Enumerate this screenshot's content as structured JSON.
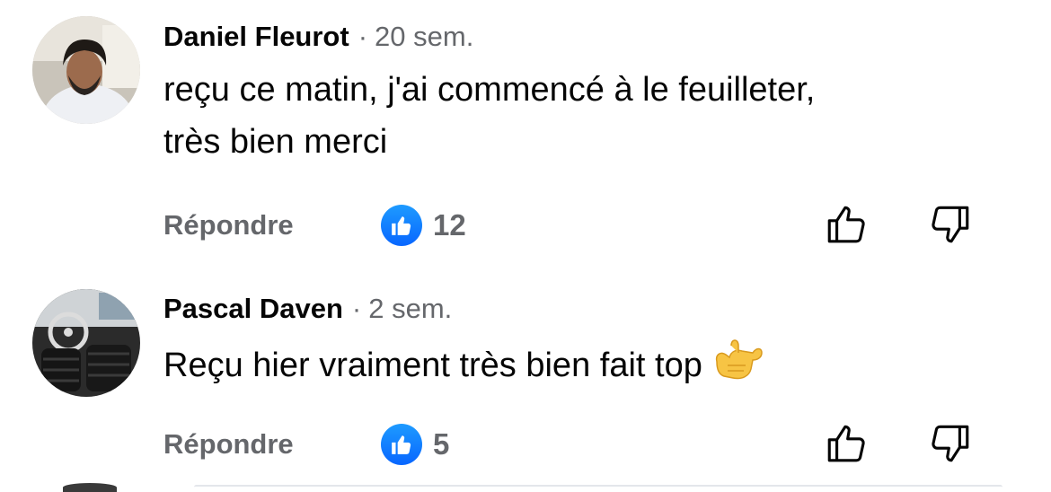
{
  "comments": [
    {
      "author": "Daniel Fleurot",
      "separator": "·",
      "time": "20 sem.",
      "text_line1": "reçu ce matin, j'ai commencé à le feuilleter,",
      "text_line2": "très bien merci",
      "reply_label": "Répondre",
      "like_count": "12",
      "avatar_icon": "person-photo-avatar"
    },
    {
      "author": "Pascal Daven",
      "separator": "·",
      "time": "2 sem.",
      "text": "Reçu hier vraiment très bien fait top",
      "emoji": "call-me-hand-emoji",
      "reply_label": "Répondre",
      "like_count": "5",
      "avatar_icon": "car-interior-avatar"
    }
  ],
  "icons": {
    "like_badge": "thumbs-up-badge-icon",
    "like_button": "thumbs-up-outline-icon",
    "dislike_button": "thumbs-down-outline-icon"
  },
  "colors": {
    "text_primary": "#050505",
    "text_secondary": "#65676b",
    "like_blue": "#0866ff"
  }
}
